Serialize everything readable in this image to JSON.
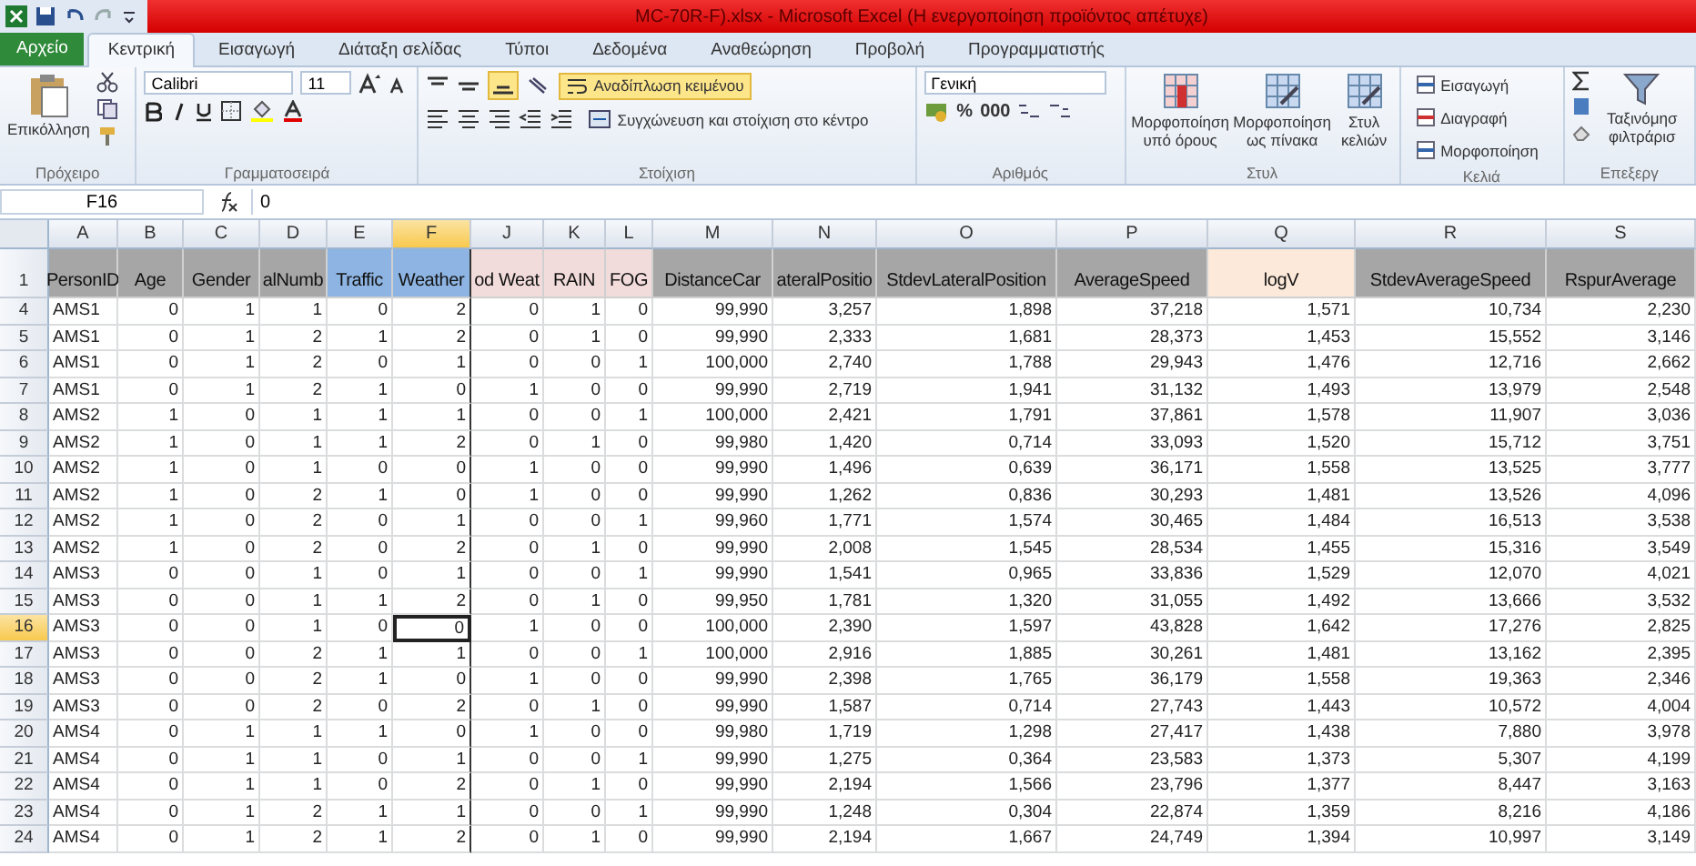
{
  "window": {
    "title": "MC-70R-F).xlsx - Microsoft Excel (Η ενεργοποίηση προϊόντος απέτυχε)"
  },
  "tabs": [
    {
      "label": "Αρχείο",
      "kind": "file",
      "selected": false
    },
    {
      "label": "Κεντρική",
      "kind": "tab",
      "selected": true
    },
    {
      "label": "Εισαγωγή",
      "kind": "tab",
      "selected": false
    },
    {
      "label": "Διάταξη σελίδας",
      "kind": "tab",
      "selected": false
    },
    {
      "label": "Τύποι",
      "kind": "tab",
      "selected": false
    },
    {
      "label": "Δεδομένα",
      "kind": "tab",
      "selected": false
    },
    {
      "label": "Αναθεώρηση",
      "kind": "tab",
      "selected": false
    },
    {
      "label": "Προβολή",
      "kind": "tab",
      "selected": false
    },
    {
      "label": "Προγραμματιστής",
      "kind": "tab",
      "selected": false
    }
  ],
  "ribbon": {
    "groups": [
      {
        "kind": "clipboard",
        "label": "Πρόχειρο",
        "paste": "Επικόλληση"
      },
      {
        "kind": "font",
        "label": "Γραμματοσειρά",
        "font": "Calibri",
        "size": "11"
      },
      {
        "kind": "alignment",
        "label": "Στοίχιση",
        "wrap": "Αναδίπλωση κειμένου",
        "wrap_on": true,
        "align_bottom": true,
        "merge": "Συγχώνευση και στοίχιση στο κέντρο"
      },
      {
        "kind": "number",
        "label": "Αριθμός",
        "format": "Γενική",
        "percent": "%",
        "thousands": "000"
      },
      {
        "kind": "styles",
        "label": "Στυλ",
        "buttons": [
          "Μορφοποίηση υπό όρους",
          "Μορφοποίηση ως πίνακα",
          "Στυλ κελιών"
        ]
      },
      {
        "kind": "cells",
        "label": "Κελιά",
        "buttons": [
          "Εισαγωγή",
          "Διαγραφή",
          "Μορφοποίηση"
        ]
      },
      {
        "kind": "editing",
        "label": "Επεξεργ",
        "sort": "Ταξινόμησ φιλτράρισ"
      }
    ]
  },
  "formula_bar": {
    "name_box": "F16",
    "value": "0"
  },
  "columns": [
    {
      "letter": "A",
      "header": "PersonID",
      "color": "#a6a6a6",
      "selected": false
    },
    {
      "letter": "B",
      "header": "Age",
      "color": "#a6a6a6",
      "selected": false
    },
    {
      "letter": "C",
      "header": "Gender",
      "color": "#a6a6a6",
      "selected": false
    },
    {
      "letter": "D",
      "header": "alNumb",
      "color": "#a6a6a6",
      "selected": false
    },
    {
      "letter": "E",
      "header": "Traffic",
      "color": "#8db4e2",
      "selected": false
    },
    {
      "letter": "F",
      "header": "Weather",
      "color": "#8db4e2",
      "selected": true
    },
    {
      "letter": "J",
      "header": "od Weat",
      "color": "#f2dcdb",
      "selected": false
    },
    {
      "letter": "K",
      "header": "RAIN",
      "color": "#f2dcdb",
      "selected": false
    },
    {
      "letter": "L",
      "header": "FOG",
      "color": "#f2dcdb",
      "selected": false
    },
    {
      "letter": "M",
      "header": "DistanceCar",
      "color": "#a6a6a6",
      "selected": false
    },
    {
      "letter": "N",
      "header": "ateralPositio",
      "color": "#a6a6a6",
      "selected": false
    },
    {
      "letter": "O",
      "header": "StdevLateralPosition",
      "color": "#a6a6a6",
      "selected": false
    },
    {
      "letter": "P",
      "header": "AverageSpeed",
      "color": "#a6a6a6",
      "selected": false
    },
    {
      "letter": "Q",
      "header": "logV",
      "color": "#fde9d9",
      "selected": false
    },
    {
      "letter": "R",
      "header": "StdevAverageSpeed",
      "color": "#a6a6a6",
      "selected": false
    },
    {
      "letter": "S",
      "header": "RspurAverage",
      "color": "#a6a6a6",
      "selected": false
    }
  ],
  "header_row": "1",
  "rows": [
    {
      "number": "4",
      "selected": false,
      "cells": [
        "AMS1",
        "0",
        "1",
        "1",
        "0",
        "2",
        "0",
        "1",
        "0",
        "99,990",
        "3,257",
        "1,898",
        "37,218",
        "1,571",
        "10,734",
        "2,230"
      ]
    },
    {
      "number": "5",
      "selected": false,
      "cells": [
        "AMS1",
        "0",
        "1",
        "2",
        "1",
        "2",
        "0",
        "1",
        "0",
        "99,990",
        "2,333",
        "1,681",
        "28,373",
        "1,453",
        "15,552",
        "3,146"
      ]
    },
    {
      "number": "6",
      "selected": false,
      "cells": [
        "AMS1",
        "0",
        "1",
        "2",
        "0",
        "1",
        "0",
        "0",
        "1",
        "100,000",
        "2,740",
        "1,788",
        "29,943",
        "1,476",
        "12,716",
        "2,662"
      ]
    },
    {
      "number": "7",
      "selected": false,
      "cells": [
        "AMS1",
        "0",
        "1",
        "2",
        "1",
        "0",
        "1",
        "0",
        "0",
        "99,990",
        "2,719",
        "1,941",
        "31,132",
        "1,493",
        "13,979",
        "2,548"
      ]
    },
    {
      "number": "8",
      "selected": false,
      "cells": [
        "AMS2",
        "1",
        "0",
        "1",
        "1",
        "1",
        "0",
        "0",
        "1",
        "100,000",
        "2,421",
        "1,791",
        "37,861",
        "1,578",
        "11,907",
        "3,036"
      ]
    },
    {
      "number": "9",
      "selected": false,
      "cells": [
        "AMS2",
        "1",
        "0",
        "1",
        "1",
        "2",
        "0",
        "1",
        "0",
        "99,980",
        "1,420",
        "0,714",
        "33,093",
        "1,520",
        "15,712",
        "3,751"
      ]
    },
    {
      "number": "10",
      "selected": false,
      "cells": [
        "AMS2",
        "1",
        "0",
        "1",
        "0",
        "0",
        "1",
        "0",
        "0",
        "99,990",
        "1,496",
        "0,639",
        "36,171",
        "1,558",
        "13,525",
        "3,777"
      ]
    },
    {
      "number": "11",
      "selected": false,
      "cells": [
        "AMS2",
        "1",
        "0",
        "2",
        "1",
        "0",
        "1",
        "0",
        "0",
        "99,990",
        "1,262",
        "0,836",
        "30,293",
        "1,481",
        "13,526",
        "4,096"
      ]
    },
    {
      "number": "12",
      "selected": false,
      "cells": [
        "AMS2",
        "1",
        "0",
        "2",
        "0",
        "1",
        "0",
        "0",
        "1",
        "99,960",
        "1,771",
        "1,574",
        "30,465",
        "1,484",
        "16,513",
        "3,538"
      ]
    },
    {
      "number": "13",
      "selected": false,
      "cells": [
        "AMS2",
        "1",
        "0",
        "2",
        "0",
        "2",
        "0",
        "1",
        "0",
        "99,990",
        "2,008",
        "1,545",
        "28,534",
        "1,455",
        "15,316",
        "3,549"
      ]
    },
    {
      "number": "14",
      "selected": false,
      "cells": [
        "AMS3",
        "0",
        "0",
        "1",
        "0",
        "1",
        "0",
        "0",
        "1",
        "99,990",
        "1,541",
        "0,965",
        "33,836",
        "1,529",
        "12,070",
        "4,021"
      ]
    },
    {
      "number": "15",
      "selected": false,
      "cells": [
        "AMS3",
        "0",
        "0",
        "1",
        "1",
        "2",
        "0",
        "1",
        "0",
        "99,950",
        "1,781",
        "1,320",
        "31,055",
        "1,492",
        "13,666",
        "3,532"
      ]
    },
    {
      "number": "16",
      "selected": true,
      "cells": [
        "AMS3",
        "0",
        "0",
        "1",
        "0",
        "0",
        "1",
        "0",
        "0",
        "100,000",
        "2,390",
        "1,597",
        "43,828",
        "1,642",
        "17,276",
        "2,825"
      ]
    },
    {
      "number": "17",
      "selected": false,
      "cells": [
        "AMS3",
        "0",
        "0",
        "2",
        "1",
        "1",
        "0",
        "0",
        "1",
        "100,000",
        "2,916",
        "1,885",
        "30,261",
        "1,481",
        "13,162",
        "2,395"
      ]
    },
    {
      "number": "18",
      "selected": false,
      "cells": [
        "AMS3",
        "0",
        "0",
        "2",
        "1",
        "0",
        "1",
        "0",
        "0",
        "99,990",
        "2,398",
        "1,765",
        "36,179",
        "1,558",
        "19,363",
        "2,346"
      ]
    },
    {
      "number": "19",
      "selected": false,
      "cells": [
        "AMS3",
        "0",
        "0",
        "2",
        "0",
        "2",
        "0",
        "1",
        "0",
        "99,990",
        "1,587",
        "0,714",
        "27,743",
        "1,443",
        "10,572",
        "4,004"
      ]
    },
    {
      "number": "20",
      "selected": false,
      "cells": [
        "AMS4",
        "0",
        "1",
        "1",
        "1",
        "0",
        "1",
        "0",
        "0",
        "99,980",
        "1,719",
        "1,298",
        "27,417",
        "1,438",
        "7,880",
        "3,978"
      ]
    },
    {
      "number": "21",
      "selected": false,
      "cells": [
        "AMS4",
        "0",
        "1",
        "1",
        "0",
        "1",
        "0",
        "0",
        "1",
        "99,990",
        "1,275",
        "0,364",
        "23,583",
        "1,373",
        "5,307",
        "4,199"
      ]
    },
    {
      "number": "22",
      "selected": false,
      "cells": [
        "AMS4",
        "0",
        "1",
        "1",
        "0",
        "2",
        "0",
        "1",
        "0",
        "99,990",
        "2,194",
        "1,566",
        "23,796",
        "1,377",
        "8,447",
        "3,163"
      ]
    },
    {
      "number": "23",
      "selected": false,
      "cells": [
        "AMS4",
        "0",
        "1",
        "2",
        "1",
        "1",
        "0",
        "0",
        "1",
        "99,990",
        "1,248",
        "0,304",
        "22,874",
        "1,359",
        "8,216",
        "4,186"
      ]
    },
    {
      "number": "24",
      "selected": false,
      "cells": [
        "AMS4",
        "0",
        "1",
        "2",
        "1",
        "2",
        "0",
        "1",
        "0",
        "99,990",
        "2,194",
        "1,667",
        "24,749",
        "1,394",
        "10,997",
        "3,149"
      ]
    }
  ]
}
